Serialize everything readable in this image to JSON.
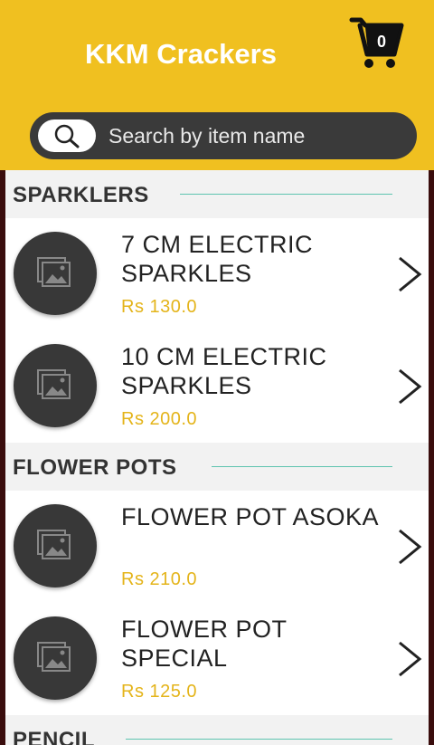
{
  "header": {
    "title": "KKM Crackers",
    "cart_count": "0",
    "cart_icon": "shopping-cart-icon",
    "background": "#f0c020"
  },
  "search": {
    "placeholder": "Search by item name",
    "icon": "search-icon"
  },
  "categories": [
    {
      "title": "SPARKLERS",
      "items": [
        {
          "name": "7 CM ELECTRIC SPARKLES",
          "price": "Rs 130.0"
        },
        {
          "name": "10 CM ELECTRIC SPARKLES",
          "price": "Rs 200.0"
        }
      ]
    },
    {
      "title": "FLOWER POTS",
      "items": [
        {
          "name": "FLOWER POT ASOKA",
          "price": "Rs 210.0"
        },
        {
          "name": "FLOWER POT SPECIAL",
          "price": "Rs 125.0"
        }
      ]
    },
    {
      "title": "PENCIL",
      "items": []
    }
  ],
  "colors": {
    "accent": "#f0c020",
    "price": "#e4b41a",
    "divider": "#5fc4b0",
    "search_bar": "#3a3a3a"
  }
}
